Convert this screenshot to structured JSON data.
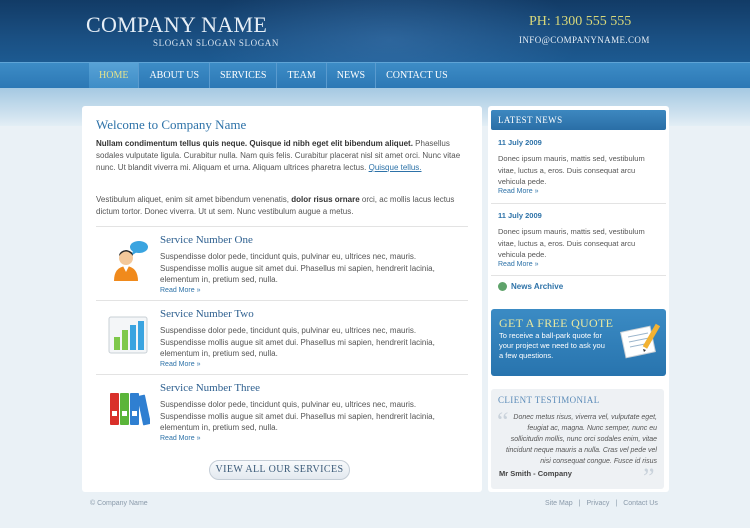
{
  "header": {
    "company_name": "COMPANY NAME",
    "slogan": "SLOGAN SLOGAN SLOGAN",
    "phone": "PH: 1300 555 555",
    "email": "INFO@COMPANYNAME.COM"
  },
  "nav": {
    "items": [
      {
        "label": "HOME",
        "active": true
      },
      {
        "label": "ABOUT US"
      },
      {
        "label": "SERVICES"
      },
      {
        "label": "TEAM"
      },
      {
        "label": "NEWS"
      },
      {
        "label": "CONTACT US"
      }
    ]
  },
  "main": {
    "title": "Welcome to Company Name",
    "intro_bold": "Nullam condimentum tellus quis neque. Quisque id nibh eget elit bibendum aliquet.",
    "intro_text": "Phasellus sodales vulputate ligula. Curabitur nulla. Nam quis felis. Curabitur placerat nisl sit amet orci. Nunc vitae nunc. Ut blandit viverra mi. Aliquam et urna. Aliquam ultrices pharetra lectus.",
    "intro_link": "Quisque tellus.",
    "para2_start": "Vestibulum aliquet, enim sit amet bibendum venenatis, ",
    "para2_bold": "dolor risus ornare",
    "para2_end": " orci, ac mollis lacus lectus dictum tortor. Donec viverra. Ut ut sem. Nunc vestibulum augue a metus.",
    "services": [
      {
        "title": "Service Number One",
        "text": "Suspendisse dolor pede, tincidunt quis, pulvinar eu, ultrices nec, mauris. Suspendisse mollis augue sit amet dui. Phasellus mi sapien, hendrerit lacinia, elementum in, pretium sed, nulla.",
        "more": "Read More »",
        "icon": "person-chat-icon"
      },
      {
        "title": "Service Number Two",
        "text": "Suspendisse dolor pede, tincidunt quis, pulvinar eu, ultrices nec, mauris. Suspendisse mollis augue sit amet dui. Phasellus mi sapien, hendrerit lacinia, elementum in, pretium sed, nulla.",
        "more": "Read More »",
        "icon": "bar-chart-icon"
      },
      {
        "title": "Service Number Three",
        "text": "Suspendisse dolor pede, tincidunt quis, pulvinar eu, ultrices nec, mauris. Suspendisse mollis augue sit amet dui. Phasellus mi sapien, hendrerit lacinia, elementum in, pretium sed, nulla.",
        "more": "Read More »",
        "icon": "binders-icon"
      }
    ],
    "view_all": "VIEW ALL OUR SERVICES"
  },
  "sidebar": {
    "news_title": "LATEST NEWS",
    "news": [
      {
        "date": "11 July 2009",
        "text": "Donec ipsum mauris, mattis sed, vestibulum vitae, luctus a, eros. Duis consequat arcu vehicula pede.",
        "more": "Read More »"
      },
      {
        "date": "11 July 2009",
        "text": "Donec ipsum mauris, mattis sed, vestibulum vitae, luctus a, eros. Duis consequat arcu vehicula pede.",
        "more": "Read More »"
      }
    ],
    "archive": "News Archive",
    "quote_title": "GET A FREE QUOTE",
    "quote_text": "To receive a ball-park quote for your project we need to ask you a few questions.",
    "testimonial_title": "CLIENT TESTIMONIAL",
    "testimonial_text": "Donec metus risus, viverra vel, vulputate eget, feugiat ac, magna. Nunc semper, nunc eu sollicitudin mollis, nunc orci sodales enim, vitae tincidunt neque mauris a nulla. Cras vel pede vel nisi consequat congue. Fusce id risus",
    "testimonial_author": "Mr Smith - Company"
  },
  "footer": {
    "copyright": "© Company Name",
    "links": [
      "Site Map",
      "Privacy",
      "Contact Us"
    ]
  },
  "colors": {
    "header_dark": "#123b66",
    "nav_blue": "#2c78b5",
    "accent_link": "#2d72a8",
    "phone_yellow": "#d8d87a"
  }
}
